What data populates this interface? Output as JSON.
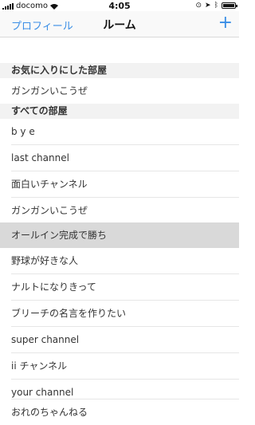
{
  "status": {
    "carrier": "docomo",
    "time": "4:05"
  },
  "nav": {
    "back_label": "プロフィール",
    "title": "ルーム",
    "add_label": "+"
  },
  "favorites": {
    "header": "お気に入りにした部屋",
    "items": [
      "ガンガンいこうぜ"
    ]
  },
  "all_rooms": {
    "header": "すべての部屋",
    "items": [
      "b y e",
      "last channel",
      "面白いチャンネル",
      "ガンガンいこうぜ",
      "オールイン完成で勝ち",
      "野球が好きな人",
      "ナルトになりきって",
      "ブリーチの名言を作りたい",
      "super channel",
      "ii チャンネル",
      "your channel",
      "おれのちゃんねる"
    ],
    "highlighted_index": 4
  },
  "colors": {
    "accent": "#3a8ee6",
    "highlight": "#d9d9d9",
    "section_bg": "#f2f2f2"
  }
}
